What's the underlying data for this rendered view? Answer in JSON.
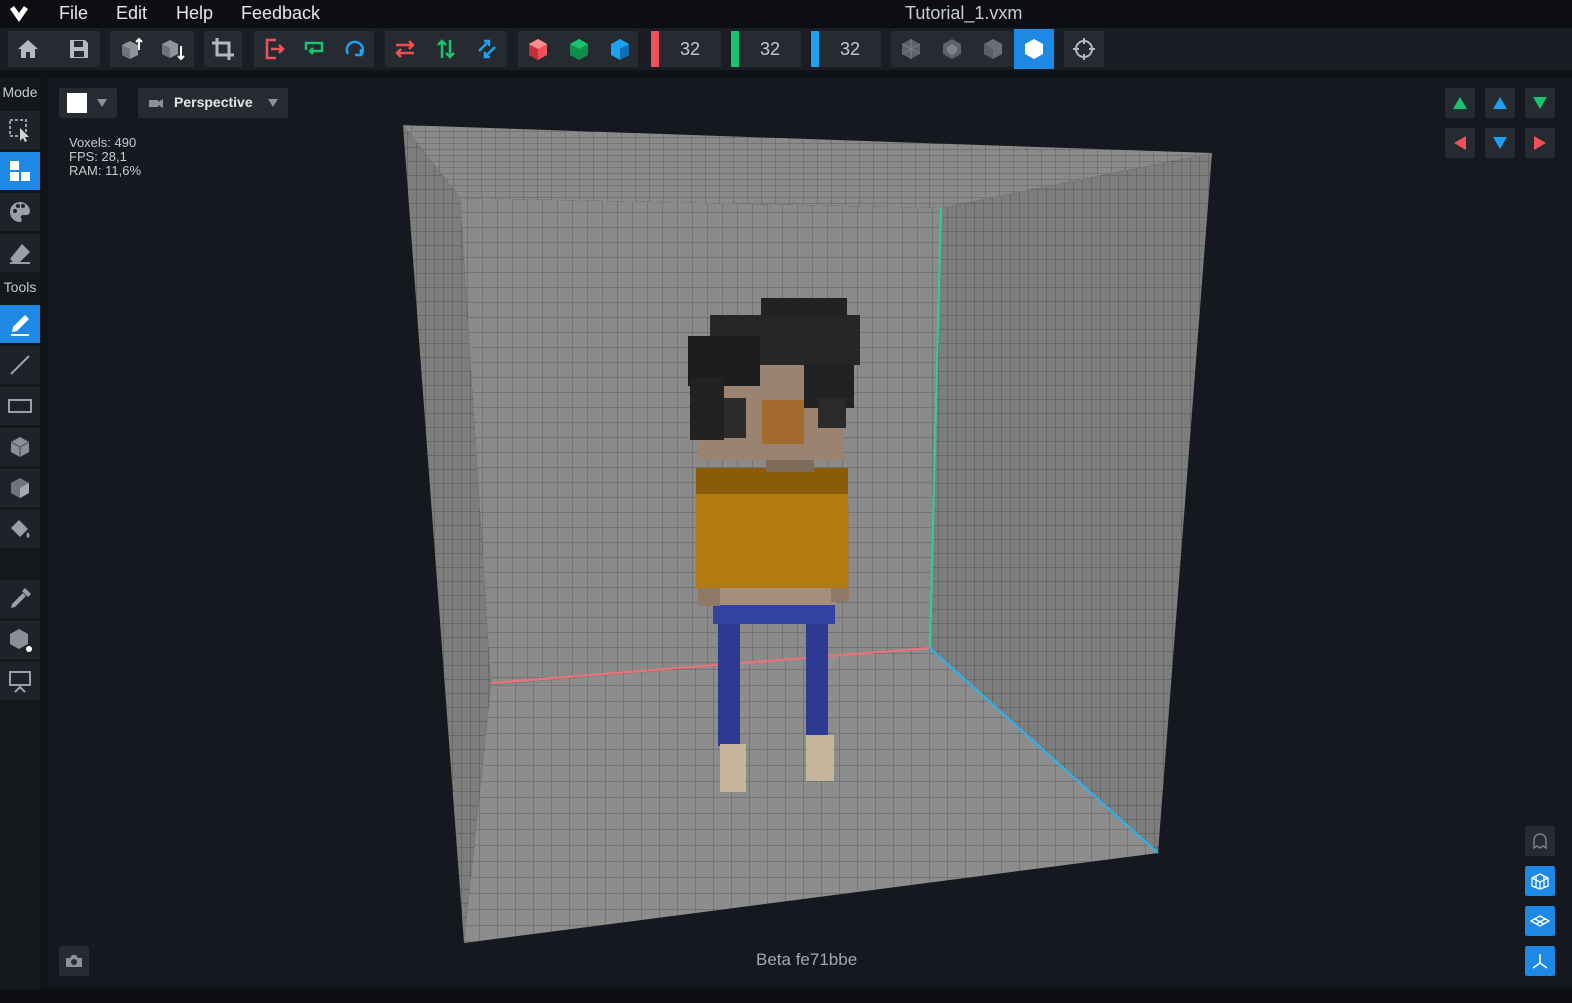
{
  "menubar": {
    "items": [
      "File",
      "Edit",
      "Help",
      "Feedback"
    ],
    "file_title": "Tutorial_1.vxm"
  },
  "toolbar": {
    "dims": {
      "x": "32",
      "y": "32",
      "z": "32"
    },
    "colors": {
      "red": "#f0505a",
      "green": "#18c46e",
      "blue": "#1ea1f0",
      "active": "#1e88e5"
    }
  },
  "sidebar": {
    "mode_label": "Mode",
    "tools_label": "Tools"
  },
  "viewport": {
    "view_mode": "Perspective",
    "stats": {
      "voxels": "Voxels: 490",
      "fps": "FPS: 28,1",
      "ram": "RAM: 11,6%"
    },
    "version": "Beta fe71bbe"
  }
}
